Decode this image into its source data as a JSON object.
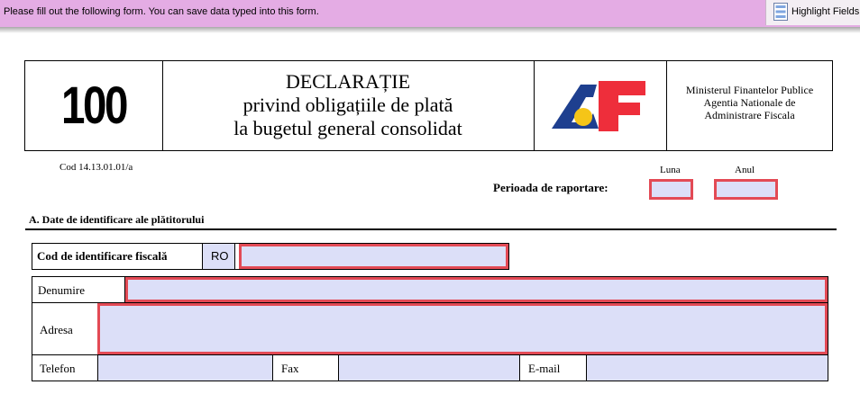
{
  "notice_bar": {
    "message": "Please fill out the following form. You can save data typed into this form.",
    "highlight_label": "Highlight Fields"
  },
  "header": {
    "form_number": "100",
    "title_lines": [
      "DECLARAȚIE",
      "privind obligațiile de plată",
      "la bugetul general consolidat"
    ],
    "logo_text": "AF",
    "ministry_lines": [
      "Ministerul Finantelor Publice",
      "Agentia Nationale de",
      "Administrare Fiscala"
    ]
  },
  "form_code": "Cod 14.13.01.01/a",
  "period": {
    "label": "Perioada de raportare:",
    "month_label": "Luna",
    "year_label": "Anul",
    "month_value": "",
    "year_value": ""
  },
  "section_a": {
    "title": "A. Date de identificare ale plătitorului",
    "cif_label": "Cod de identificare fiscală",
    "cif_prefix": "RO",
    "cif_value": "",
    "name_label": "Denumire",
    "name_value": "",
    "address_label": "Adresa",
    "address_value": "",
    "phone_label": "Telefon",
    "fax_label": "Fax",
    "email_label": "E-mail"
  },
  "colors": {
    "notice_bar": "#e4ace4",
    "field_fill": "#dcdff8",
    "field_border": "#e34a55",
    "logo_blue": "#1e3f8f",
    "logo_red": "#ee2e3b",
    "logo_yellow": "#f5c518"
  }
}
